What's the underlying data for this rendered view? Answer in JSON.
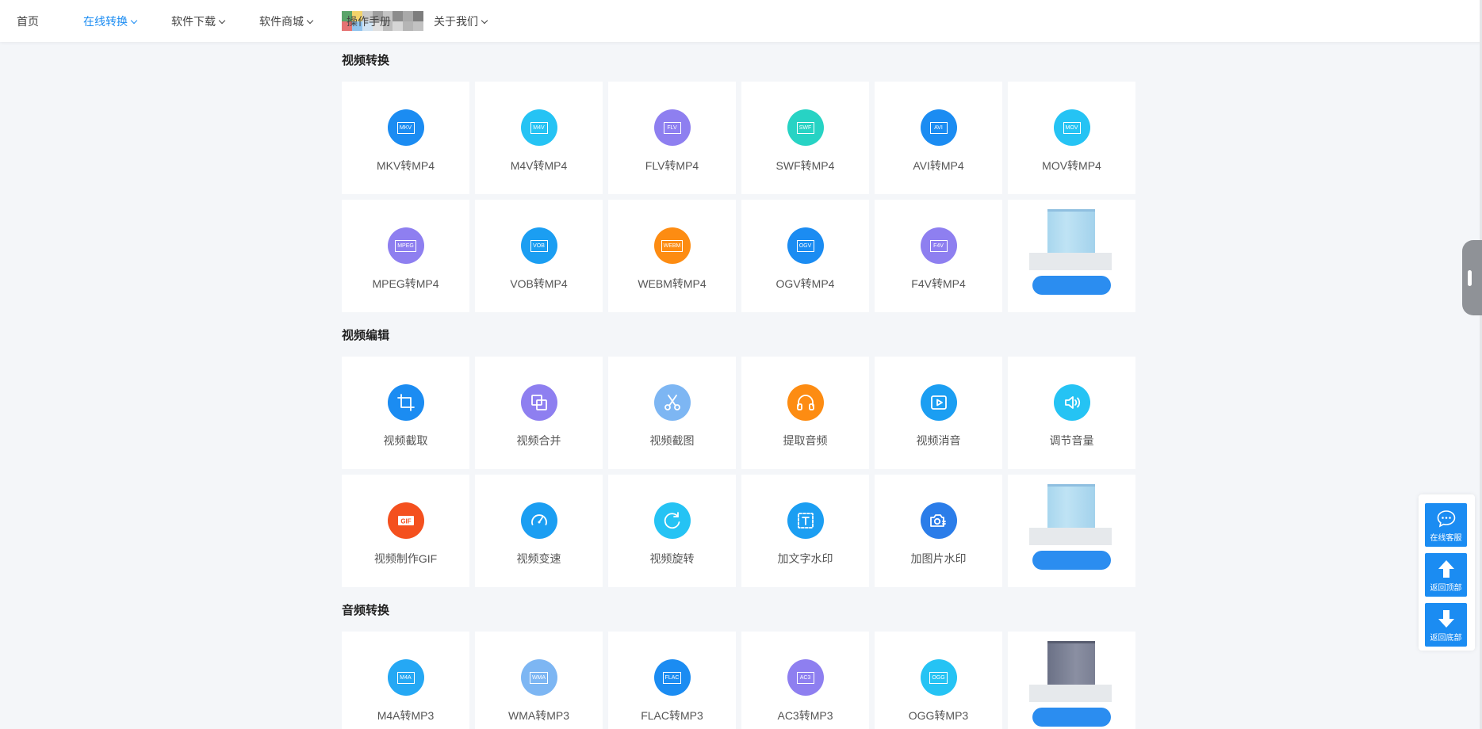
{
  "header": {
    "nav": [
      {
        "label": "首页",
        "active": false,
        "dropdown": false
      },
      {
        "label": "在线转换",
        "active": true,
        "dropdown": true
      },
      {
        "label": "软件下载",
        "active": false,
        "dropdown": true
      },
      {
        "label": "软件商城",
        "active": false,
        "dropdown": true
      },
      {
        "label": "操作手册",
        "active": false,
        "dropdown": false
      },
      {
        "label": "关于我们",
        "active": false,
        "dropdown": true
      }
    ]
  },
  "sections": [
    {
      "title": "视频转换",
      "items": [
        {
          "label": "MKV转MP4",
          "icon": "mkv-icon",
          "fmt": "MKV",
          "color": "#1b8cf2"
        },
        {
          "label": "M4V转MP4",
          "icon": "m4v-icon",
          "fmt": "M4V",
          "color": "#25c3f4"
        },
        {
          "label": "FLV转MP4",
          "icon": "flv-icon",
          "fmt": "FLV",
          "color": "#8e7ff0"
        },
        {
          "label": "SWF转MP4",
          "icon": "swf-icon",
          "fmt": "SWF",
          "color": "#27d3c4"
        },
        {
          "label": "AVI转MP4",
          "icon": "avi-icon",
          "fmt": "AVI",
          "color": "#1b8cf2"
        },
        {
          "label": "MOV转MP4",
          "icon": "mov-icon",
          "fmt": "MOV",
          "color": "#25c3f4"
        },
        {
          "label": "MPEG转MP4",
          "icon": "mpeg-icon",
          "fmt": "MPEG",
          "color": "#8e7ff0"
        },
        {
          "label": "VOB转MP4",
          "icon": "vob-icon",
          "fmt": "VOB",
          "color": "#1b9ef2"
        },
        {
          "label": "WEBM转MP4",
          "icon": "webm-icon",
          "fmt": "WEBM",
          "color": "#fd8c12"
        },
        {
          "label": "OGV转MP4",
          "icon": "ogv-icon",
          "fmt": "OGV",
          "color": "#1b8cf2"
        },
        {
          "label": "F4V转MP4",
          "icon": "f4v-icon",
          "fmt": "F4V",
          "color": "#8e7ff0"
        }
      ],
      "ad_style": "light"
    },
    {
      "title": "视频编辑",
      "items": [
        {
          "label": "视频截取",
          "icon": "crop-icon",
          "glyph": "crop",
          "color": "#1b8cf2"
        },
        {
          "label": "视频合并",
          "icon": "merge-icon",
          "glyph": "merge",
          "color": "#8e7ff0"
        },
        {
          "label": "视频截图",
          "icon": "scissors-icon",
          "glyph": "scissors",
          "color": "#7db6f3"
        },
        {
          "label": "提取音频",
          "icon": "headphones-icon",
          "glyph": "headphones",
          "color": "#fd8c12"
        },
        {
          "label": "视频消音",
          "icon": "play-icon",
          "glyph": "play",
          "color": "#1b9ef2"
        },
        {
          "label": "调节音量",
          "icon": "volume-icon",
          "glyph": "volume",
          "color": "#25c3f4"
        },
        {
          "label": "视频制作GIF",
          "icon": "gif-icon",
          "glyph": "gif",
          "color": "#f4501e"
        },
        {
          "label": "视频变速",
          "icon": "speedometer-icon",
          "glyph": "speed",
          "color": "#1b9ef2"
        },
        {
          "label": "视频旋转",
          "icon": "rotate-icon",
          "glyph": "rotate",
          "color": "#25c3f4"
        },
        {
          "label": "加文字水印",
          "icon": "text-watermark-icon",
          "glyph": "text",
          "color": "#1b9ef2"
        },
        {
          "label": "加图片水印",
          "icon": "camera-watermark-icon",
          "glyph": "camera",
          "color": "#2b7de9"
        }
      ],
      "ad_style": "light"
    },
    {
      "title": "音频转换",
      "items": [
        {
          "label": "M4A转MP3",
          "icon": "m4a-icon",
          "fmt": "M4A",
          "color": "#25a8f4"
        },
        {
          "label": "WMA转MP3",
          "icon": "wma-icon",
          "fmt": "WMA",
          "color": "#7db6f3"
        },
        {
          "label": "FLAC转MP3",
          "icon": "flac-icon",
          "fmt": "FLAC",
          "color": "#1b8cf2"
        },
        {
          "label": "AC3转MP3",
          "icon": "ac3-icon",
          "fmt": "AC3",
          "color": "#8e7ff0"
        },
        {
          "label": "OGG转MP3",
          "icon": "ogg-icon",
          "fmt": "OGG",
          "color": "#25c3f4"
        }
      ],
      "ad_style": "dark"
    }
  ],
  "side_panel": {
    "service_label": "在线客服",
    "top_label": "返回顶部",
    "bottom_label": "返回底部"
  }
}
